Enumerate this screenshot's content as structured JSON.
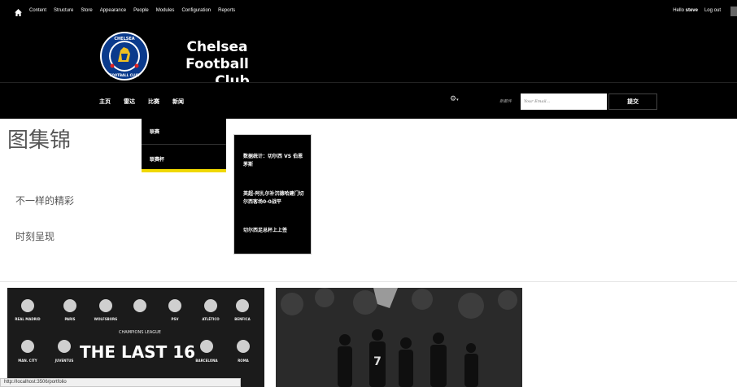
{
  "admin_toolbar": {
    "menu": [
      "Content",
      "Structure",
      "Store",
      "Appearance",
      "People",
      "Modules",
      "Configuration",
      "Reports"
    ],
    "greeting": "Hello",
    "username": "steve",
    "logout": "Log out"
  },
  "header": {
    "site_name_line1": "Chelsea Football",
    "site_name_line2": "Club",
    "logo_text": "CHELSEA FOOTBALL CLUB"
  },
  "nav": {
    "items": [
      "主页",
      "雷达",
      "比赛",
      "新闻"
    ],
    "gear_icon": "gear-icon",
    "subscribe_label": "新都件",
    "email_placeholder": "Your Email...",
    "submit_label": "提交"
  },
  "dropdown": {
    "items": [
      "联赛",
      "联赛杯"
    ]
  },
  "subdropdown": {
    "items": [
      "数据统计：切尔西 VS 伯恩茅斯",
      "英超-阿扎尔补沉德哈建门切尔西客场0-0战平",
      "切尔西足总杯上上签"
    ]
  },
  "main": {
    "title": "图集锦",
    "text1": "不一样的精彩",
    "text2": "时刻呈现",
    "card1_title": "THE LAST 16",
    "card1_subtitle": "CHAMPIONS LEAGUE",
    "card1_clubs_top": [
      "REAL MADRID",
      "PARIS",
      "WOLFSBURG",
      "",
      "PSV",
      "ATLÉTICO",
      "BENFICA"
    ],
    "card1_clubs_bottom": [
      "MAN. CITY",
      "JUVENTUS",
      "BARCELONA",
      "ROMA"
    ],
    "card2_jersey_number": "7"
  },
  "statusbar": {
    "url": "http://localhost:3506/portfolio"
  }
}
